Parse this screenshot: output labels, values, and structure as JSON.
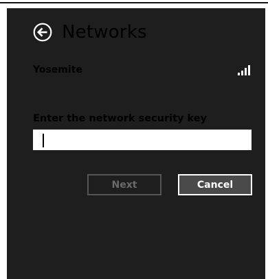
{
  "header": {
    "title": "Networks",
    "back_icon": "back-arrow-circle-icon"
  },
  "network": {
    "name": "Yosemite",
    "signal_icon": "wifi-signal-bars-icon",
    "signal_bars": 4
  },
  "security": {
    "label": "Enter the network security key",
    "value": ""
  },
  "buttons": {
    "next_label": "Next",
    "cancel_label": "Cancel"
  },
  "colors": {
    "panel_bg": "#1e1e1e",
    "text": "#ffffff",
    "disabled_text": "#6a6a6a"
  }
}
